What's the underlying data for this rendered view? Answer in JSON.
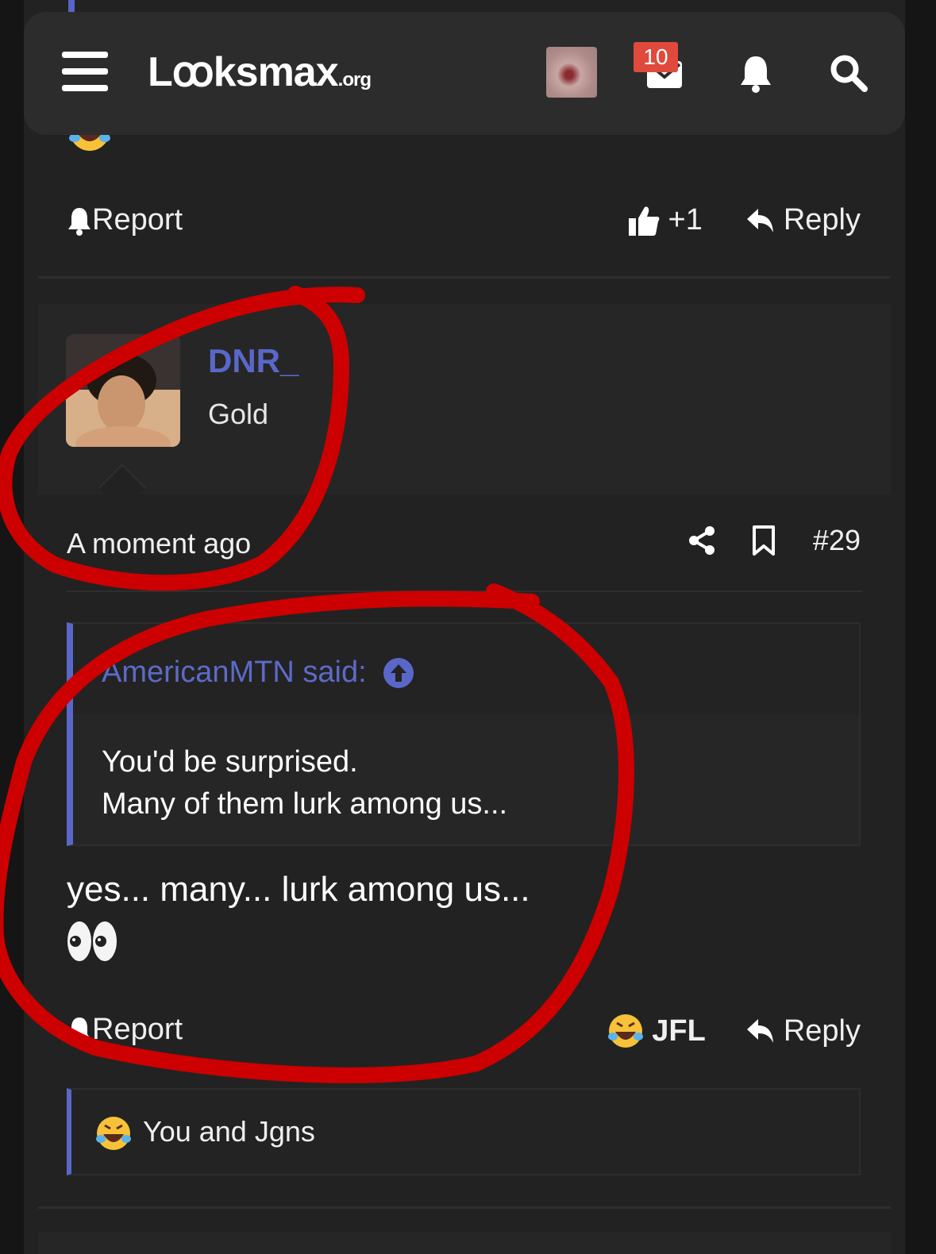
{
  "header": {
    "logo_main": "Lꝏksmax",
    "logo_tld": ".org",
    "mail_badge_count": "10",
    "icons": [
      "menu-icon",
      "mail-icon",
      "bell-icon",
      "search-icon"
    ]
  },
  "prev_post": {
    "report_label": "Report",
    "like_count": "+1",
    "reply_label": "Reply"
  },
  "post": {
    "username": "DNR_",
    "user_title": "Gold",
    "time": "A moment ago",
    "post_number": "#29",
    "quote": {
      "author": "AmericanMTN said:",
      "lines": [
        "You'd be surprised.",
        "Many of them lurk among us..."
      ]
    },
    "message": "yes... many... lurk among us...",
    "report_label": "Report",
    "reaction_label": "JFL",
    "reply_label": "Reply",
    "reactions_summary": "You and Jgns"
  },
  "colors": {
    "accent": "#5a67c9",
    "badge": "#e04a3c",
    "annotation": "#cc0000",
    "background": "#222222"
  }
}
